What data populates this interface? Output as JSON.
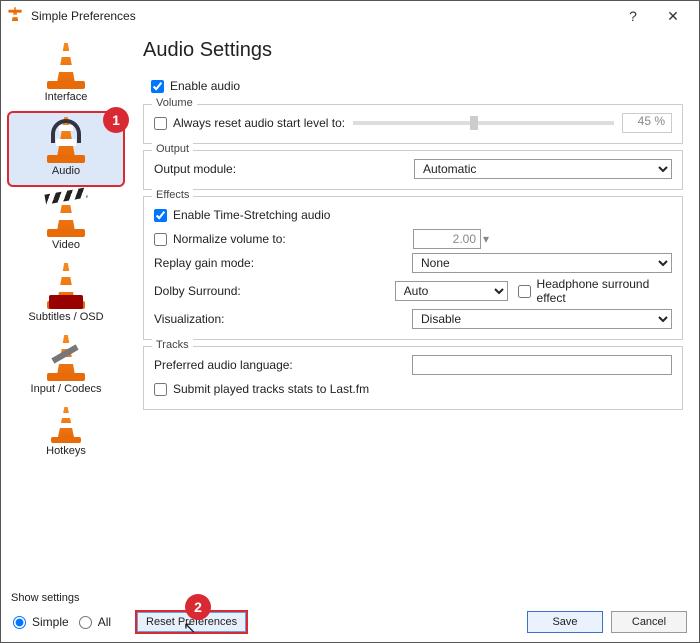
{
  "window": {
    "title": "Simple Preferences"
  },
  "sidebar": {
    "items": [
      {
        "label": "Interface"
      },
      {
        "label": "Audio"
      },
      {
        "label": "Video"
      },
      {
        "label": "Subtitles / OSD"
      },
      {
        "label": "Input / Codecs"
      },
      {
        "label": "Hotkeys"
      }
    ]
  },
  "main": {
    "heading": "Audio Settings",
    "enable_audio": "Enable audio",
    "volume": {
      "group": "Volume",
      "reset_label": "Always reset audio start level to:",
      "percent": "45 %"
    },
    "output": {
      "group": "Output",
      "module_label": "Output module:",
      "module_value": "Automatic"
    },
    "effects": {
      "group": "Effects",
      "timestretch": "Enable Time-Stretching audio",
      "normalize": "Normalize volume to:",
      "normalize_value": "2.00",
      "replay_label": "Replay gain mode:",
      "replay_value": "None",
      "dolby_label": "Dolby Surround:",
      "dolby_value": "Auto",
      "headphone": "Headphone surround effect",
      "viz_label": "Visualization:",
      "viz_value": "Disable"
    },
    "tracks": {
      "group": "Tracks",
      "lang_label": "Preferred audio language:",
      "lastfm": "Submit played tracks stats to Last.fm"
    }
  },
  "bottom": {
    "show_settings": "Show settings",
    "simple": "Simple",
    "all": "All",
    "reset": "Reset Preferences",
    "save": "Save",
    "cancel": "Cancel"
  },
  "annotations": {
    "one": "1",
    "two": "2"
  }
}
